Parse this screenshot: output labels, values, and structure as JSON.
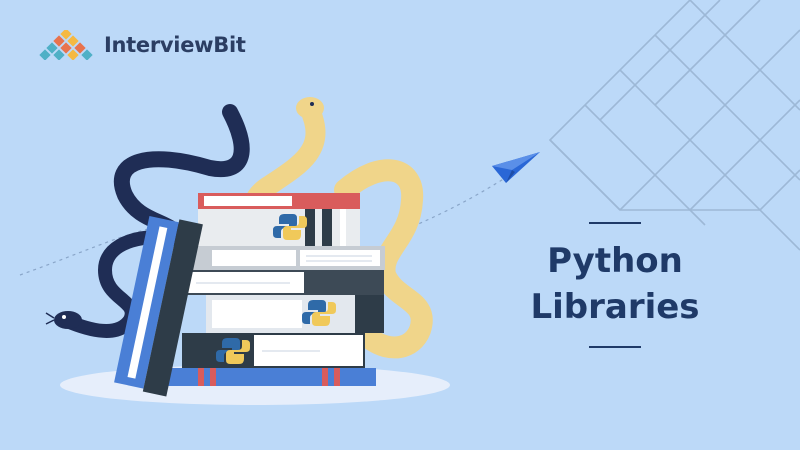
{
  "brand": {
    "name": "InterviewBit"
  },
  "title": {
    "line1": "Python",
    "line2": "Libraries"
  },
  "colors": {
    "background": "#bcd9f8",
    "title": "#1f3a68",
    "brand_text": "#2b3e63",
    "python_yellow": "#f0c95a",
    "python_blue": "#2f6aa8",
    "snake_navy": "#1f2d55",
    "snake_yellow": "#f0d58a",
    "book_red": "#d95c5c",
    "book_blue": "#4a7fd6",
    "book_dark": "#2e3c48"
  },
  "icons": [
    "brand-logo-icon",
    "python-logo-icon",
    "paper-plane-icon",
    "snake-illustration",
    "book-stack-illustration"
  ]
}
